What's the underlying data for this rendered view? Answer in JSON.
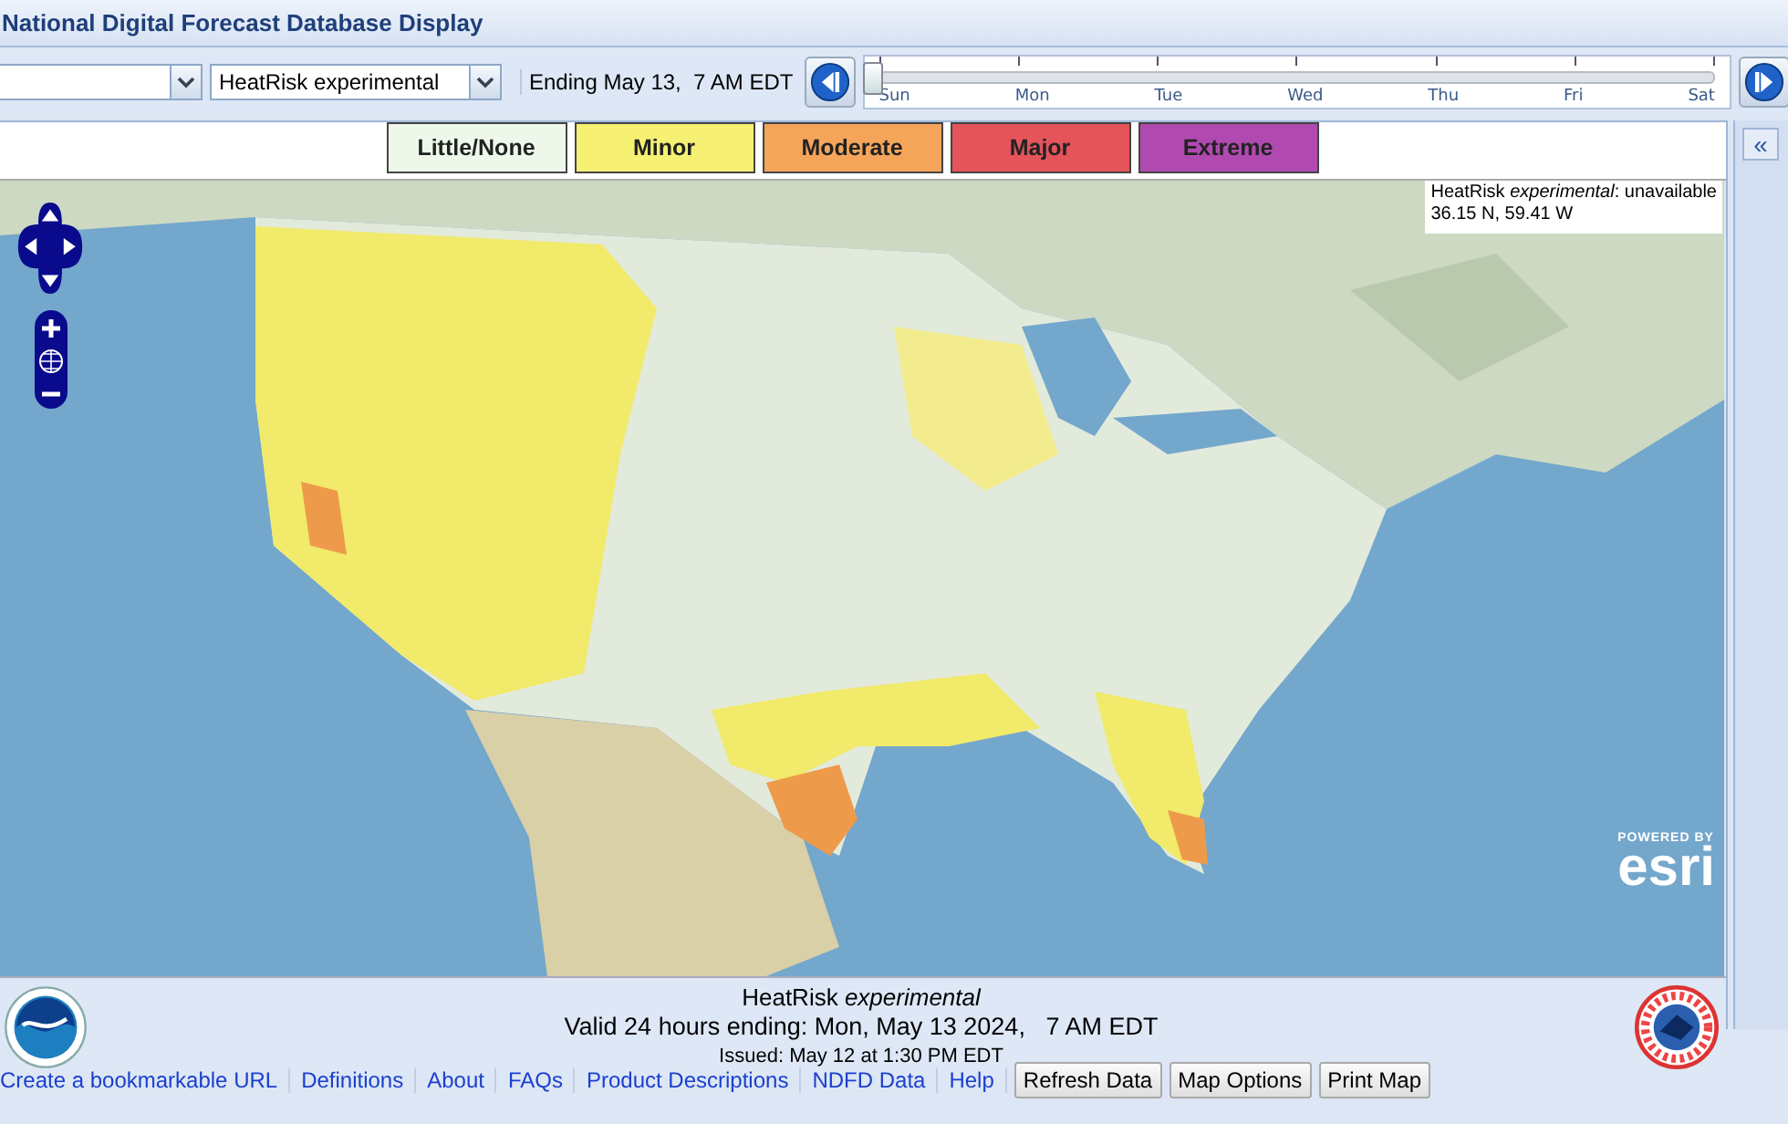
{
  "window": {
    "title": "National Digital Forecast Database Display"
  },
  "controls": {
    "element_select": {
      "value": "HeatRisk experimental"
    },
    "ending": "Ending May 13,  7 AM EDT",
    "timeline": {
      "days": [
        "Sun",
        "Mon",
        "Tue",
        "Wed",
        "Thu",
        "Fri",
        "Sat"
      ],
      "level": 0.0
    }
  },
  "legend": [
    {
      "label": "Little/None",
      "color": "#eef8ea"
    },
    {
      "label": "Minor",
      "color": "#f6f173"
    },
    {
      "label": "Moderate",
      "color": "#f5a55a"
    },
    {
      "label": "Major",
      "color": "#e4545a"
    },
    {
      "label": "Extreme",
      "color": "#b04ab0"
    }
  ],
  "map": {
    "kind": "picture",
    "info": {
      "line_1": "HeatRisk *experimental*: unavailable",
      "line_2": "36.15 N, 59.41 W"
    },
    "attribution": {
      "small": "POWERED BY",
      "big": "esri"
    }
  },
  "footer": {
    "product": "HeatRisk *experimental*",
    "valid": "Valid 24 hours ending: Mon, May 13 2024,   7 AM EDT",
    "issued": "Issued: May 12 at 1:30 PM EDT"
  },
  "links": [
    {
      "label": "Create a bookmarkable URL",
      "kind": "link"
    },
    {
      "label": "Definitions",
      "kind": "link"
    },
    {
      "label": "About",
      "kind": "link"
    },
    {
      "label": "FAQs",
      "kind": "link"
    },
    {
      "label": "Product Descriptions",
      "kind": "link"
    },
    {
      "label": "NDFD Data",
      "kind": "link"
    },
    {
      "label": "Help",
      "kind": "link"
    },
    {
      "label": "Refresh Data",
      "kind": "button"
    },
    {
      "label": "Map Options",
      "kind": "button"
    },
    {
      "label": "Print Map",
      "kind": "button"
    }
  ],
  "sidebar": {
    "collapse": "«"
  }
}
